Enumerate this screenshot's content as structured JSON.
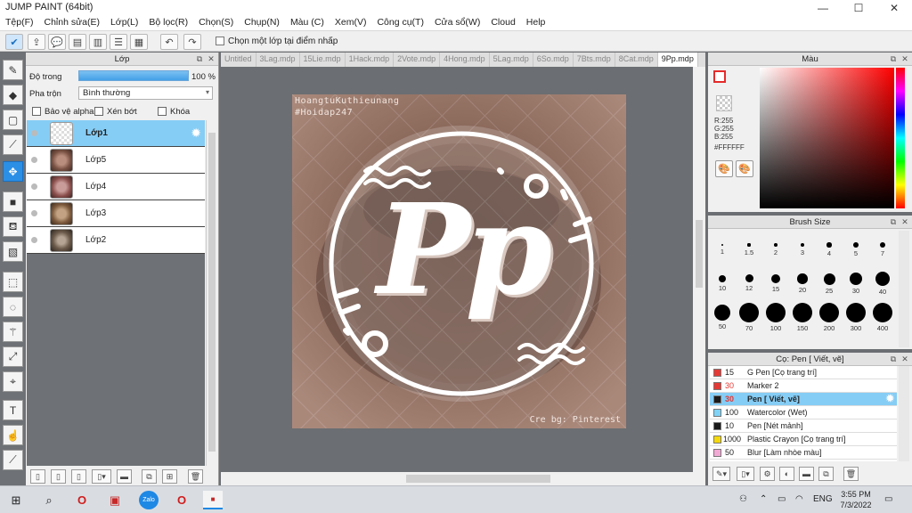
{
  "window": {
    "title": "JUMP PAINT (64bit)",
    "minimize_glyph": "—",
    "maximize_glyph": "☐",
    "close_glyph": "✕"
  },
  "menu": [
    "Tệp(F)",
    "Chỉnh sửa(E)",
    "Lớp(L)",
    "Bộ lọc(R)",
    "Chọn(S)",
    "Chụp(N)",
    "Màu (C)",
    "Xem(V)",
    "Công cụ(T)",
    "Cửa sổ(W)",
    "Cloud",
    "Help"
  ],
  "toolbar": {
    "checkbox_label": "Chọn một lớp tại điểm nhấp",
    "checkbox_checked": false,
    "icons": [
      "brush-settings-icon",
      "export-icon",
      "comment-icon",
      "message-icon",
      "document-icon",
      "list-icon",
      "grid-icon",
      "undo-icon",
      "redo-icon"
    ]
  },
  "tools": [
    "pen-icon",
    "eraser-icon",
    "select-rect-icon",
    "line-icon",
    "move-icon",
    "fill-rect-icon",
    "bucket-icon",
    "gradient-icon",
    "rect-select-icon",
    "lasso-icon",
    "magic-wand-icon",
    "transform-icon",
    "auto-select-icon",
    "text-icon",
    "hand-icon",
    "eyedropper-icon"
  ],
  "active_tool_index": 4,
  "layer_panel": {
    "title": "Lớp",
    "opacity_label": "Độ trong",
    "opacity_value": "100 %",
    "opacity_fraction": 1.0,
    "blend_label": "Pha trộn",
    "blend_value": "Bình thường",
    "protect_alpha_label": "Bảo vệ alpha",
    "clip_label": "Xén bớt",
    "lock_label": "Khóa",
    "layers": [
      {
        "name": "Lớp1",
        "selected": true
      },
      {
        "name": "Lớp5",
        "selected": false
      },
      {
        "name": "Lớp4",
        "selected": false
      },
      {
        "name": "Lớp3",
        "selected": false
      },
      {
        "name": "Lớp2",
        "selected": false
      }
    ]
  },
  "tabs": [
    {
      "label": "Untitled",
      "active": false
    },
    {
      "label": "3Lag.mdp",
      "active": false
    },
    {
      "label": "15Lie.mdp",
      "active": false
    },
    {
      "label": "1Hack.mdp",
      "active": false
    },
    {
      "label": "2Vote.mdp",
      "active": false
    },
    {
      "label": "4Hong.mdp",
      "active": false
    },
    {
      "label": "5Lag.mdp",
      "active": false
    },
    {
      "label": "6So.mdp",
      "active": false
    },
    {
      "label": "7Bts.mdp",
      "active": false
    },
    {
      "label": "8Cat.mdp",
      "active": false
    },
    {
      "label": "9Pp.mdp",
      "active": true
    }
  ],
  "artwork": {
    "watermark_top": "HoangtuKuthieunang",
    "hashtag": "#Hoidap247",
    "credit": "Cre bg: Pinterest",
    "monogram": "Pp"
  },
  "color_panel": {
    "title": "Màu",
    "r": "R:255",
    "g": "G:255",
    "b": "B:255",
    "hex": "#FFFFFF"
  },
  "brush_panel": {
    "title": "Brush Size",
    "sizes": [
      "1",
      "1.5",
      "2",
      "3",
      "4",
      "5",
      "7",
      "10",
      "12",
      "15",
      "20",
      "25",
      "30",
      "40",
      "50",
      "70",
      "100",
      "150",
      "200",
      "300",
      "400"
    ]
  },
  "tool_panel": {
    "title": "Cọ: Pen [ Viết, vẽ]",
    "presets": [
      {
        "size": "15",
        "name": "G Pen [Cọ trang trí]",
        "color": "#e53935",
        "selected": false
      },
      {
        "size": "30",
        "name": "Marker 2",
        "color": "#e53935",
        "selected": false
      },
      {
        "size": "30",
        "name": "Pen [ Viết, vẽ]",
        "color": "#1a1a1a",
        "selected": true
      },
      {
        "size": "100",
        "name": "Watercolor (Wet)",
        "color": "#7fd3f7",
        "selected": false
      },
      {
        "size": "10",
        "name": "Pen [Nét mảnh]",
        "color": "#1a1a1a",
        "selected": false
      },
      {
        "size": "1000",
        "name": "Plastic Crayon [Cọ trang trí]",
        "color": "#f5d90a",
        "selected": false
      },
      {
        "size": "50",
        "name": "Blur [Làm nhòe màu]",
        "color": "#f2a9d4",
        "selected": false
      }
    ]
  },
  "taskbar": {
    "lang": "ENG",
    "time": "3:55 PM",
    "date": "7/3/2022",
    "app_zalo": "Zalo"
  }
}
